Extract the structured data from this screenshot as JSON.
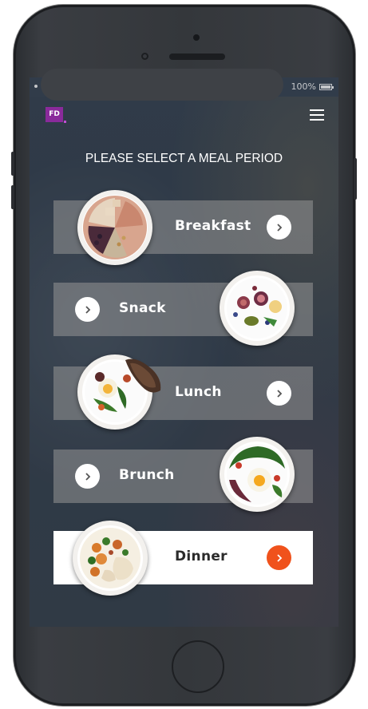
{
  "status_bar": {
    "battery_text": "100%"
  },
  "header": {
    "logo_text": "FD",
    "menu_icon": "hamburger-menu-icon"
  },
  "title": "PLEASE SELECT A MEAL PERIOD",
  "meals": [
    {
      "label": "Breakfast",
      "selected": false
    },
    {
      "label": "Snack",
      "selected": false
    },
    {
      "label": "Lunch",
      "selected": false
    },
    {
      "label": "Brunch",
      "selected": false
    },
    {
      "label": "Dinner",
      "selected": true
    }
  ],
  "colors": {
    "accent": "#f0521c",
    "logo": "#8a2a9b",
    "card": "#969696",
    "selected_card": "#ffffff"
  },
  "icons": {
    "arrow": "chevron-right-icon"
  }
}
